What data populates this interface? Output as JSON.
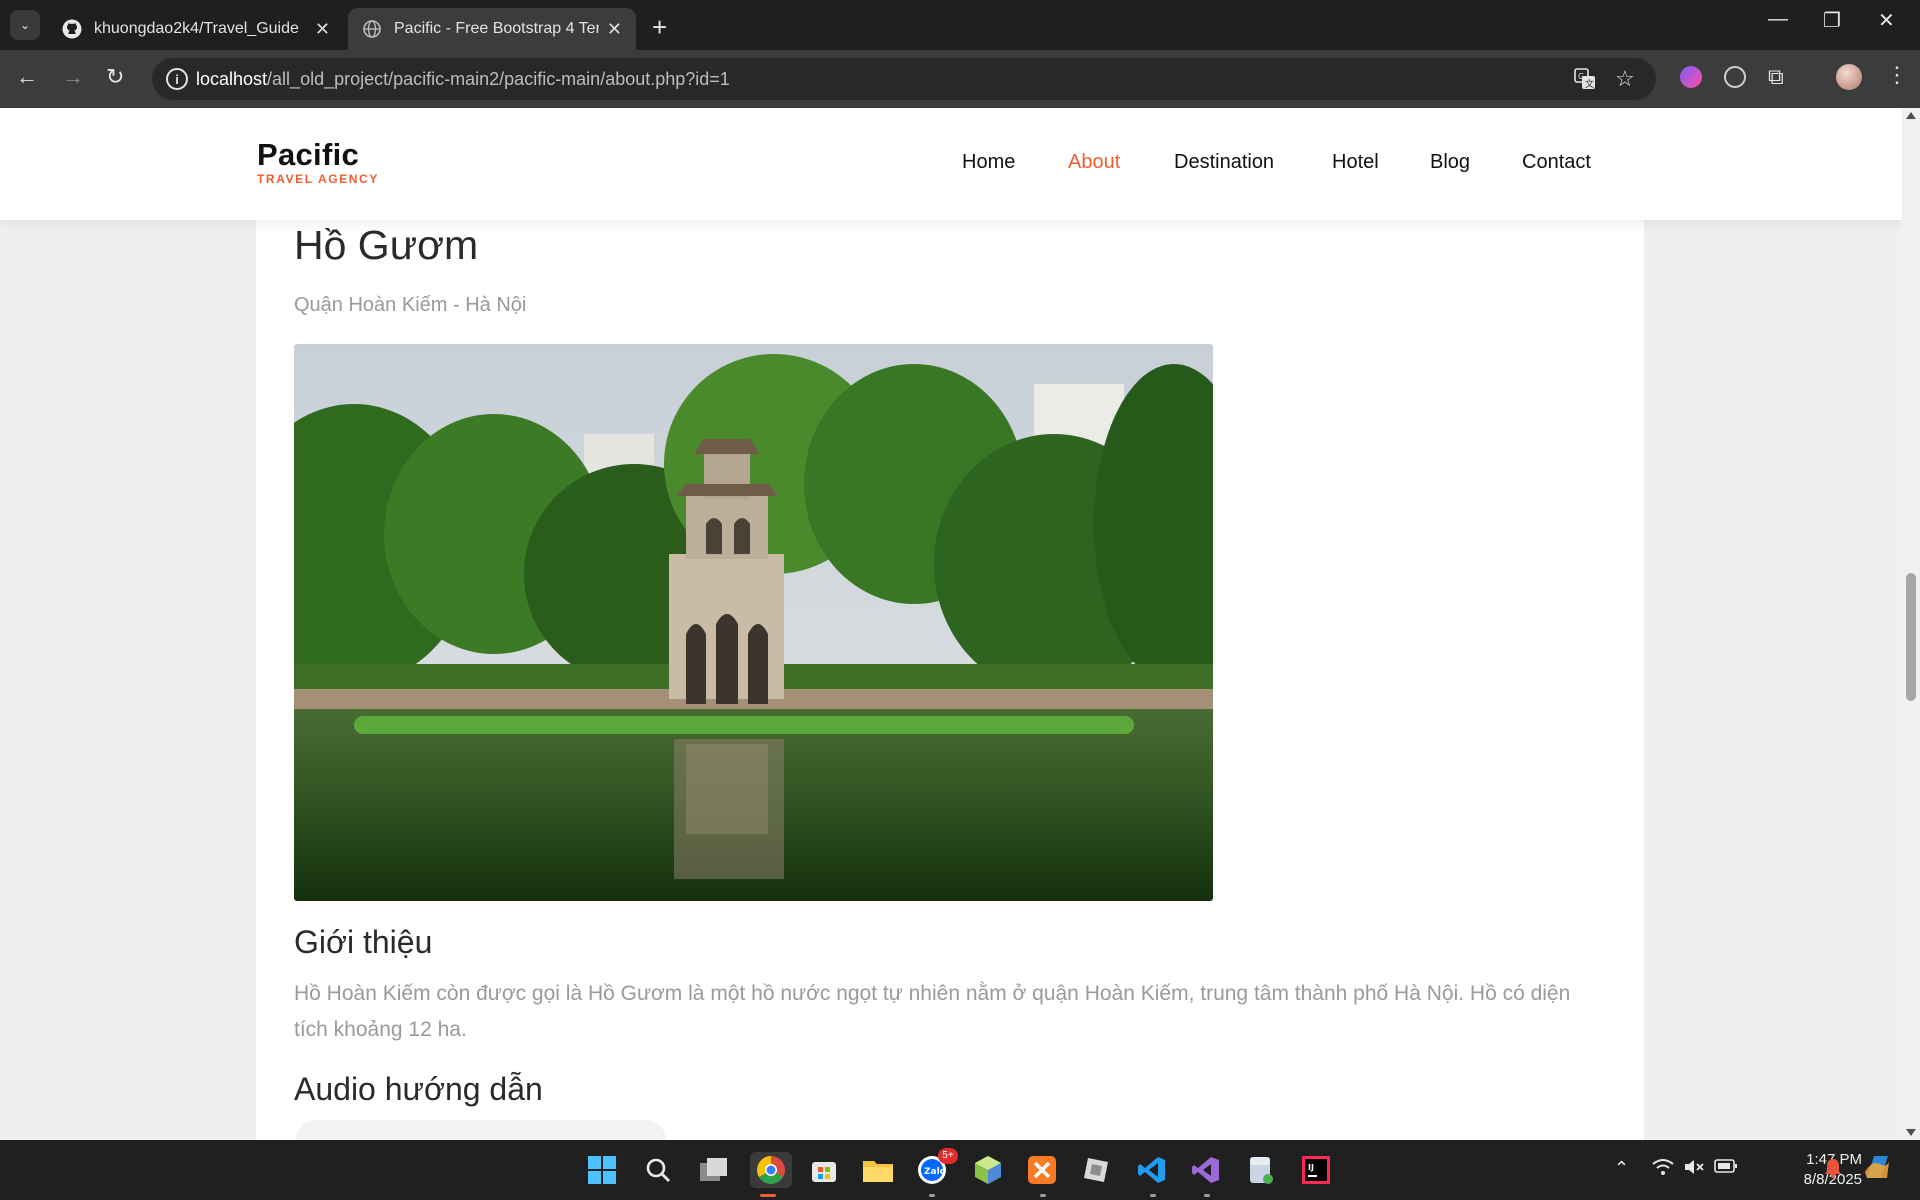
{
  "browser": {
    "tabs": [
      {
        "title": "khuongdao2k4/Travel_Guide",
        "icon": "github-icon"
      },
      {
        "title": "Pacific - Free Bootstrap 4 Template",
        "icon": "globe-icon"
      }
    ],
    "url_host": "localhost",
    "url_path": "/all_old_project/pacific-main2/pacific-main/about.php?id=1"
  },
  "site": {
    "logo_name": "Pacific",
    "logo_tag": "TRAVEL AGENCY",
    "accent": "#f15d30",
    "nav": [
      {
        "label": "Home",
        "active": false
      },
      {
        "label": "About",
        "active": true
      },
      {
        "label": "Destination",
        "active": false
      },
      {
        "label": "Hotel",
        "active": false
      },
      {
        "label": "Blog",
        "active": false
      },
      {
        "label": "Contact",
        "active": false
      }
    ]
  },
  "place": {
    "title": "Hồ Gươm",
    "subtitle": "Quận Hoàn Kiếm - Hà Nội",
    "intro_heading": "Giới thiệu",
    "intro_text": "Hồ Hoàn Kiếm còn được gọi là Hồ Gươm là một hồ nước ngọt tự nhiên nằm ở quận Hoàn Kiếm, trung tâm thành phố Hà Nội. Hồ có diện tích khoảng 12 ha.",
    "audio_heading": "Audio hướng dẫn"
  },
  "taskbar": {
    "time": "1:47 PM",
    "date": "8/8/2025",
    "zalo_badge": "5+"
  }
}
